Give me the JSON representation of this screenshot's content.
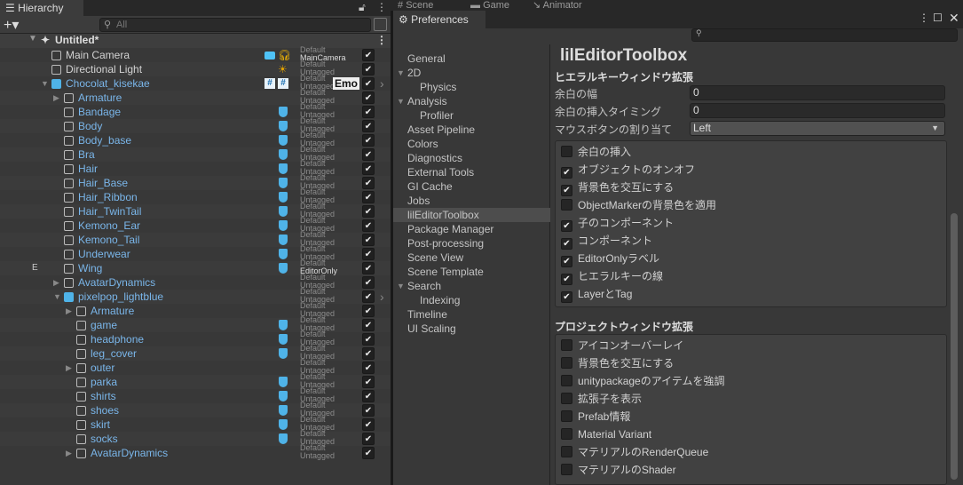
{
  "hierarchy": {
    "tab": "Hierarchy",
    "search_placeholder": "All",
    "scene": "Untitled*",
    "rows": [
      {
        "name": "Main Camera",
        "color": "white",
        "indent": 0,
        "layer": "Default",
        "tag": "MainCamera",
        "arrow": ""
      },
      {
        "name": "Directional Light",
        "color": "white",
        "indent": 0,
        "layer": "Default",
        "tag": "Untagged",
        "arrow": ""
      },
      {
        "name": "Chocolat_kisekae",
        "color": "blue",
        "indent": 0,
        "layer": "Default",
        "tag": "Untagged",
        "arrow": "▼",
        "badge": "Emo"
      },
      {
        "name": "Armature",
        "color": "blue",
        "indent": 1,
        "layer": "Default",
        "tag": "Untagged",
        "arrow": "▶"
      },
      {
        "name": "Bandage",
        "color": "blue",
        "indent": 1,
        "layer": "Default",
        "tag": "Untagged",
        "arrow": ""
      },
      {
        "name": "Body",
        "color": "blue",
        "indent": 1,
        "layer": "Default",
        "tag": "Untagged",
        "arrow": ""
      },
      {
        "name": "Body_base",
        "color": "blue",
        "indent": 1,
        "layer": "Default",
        "tag": "Untagged",
        "arrow": ""
      },
      {
        "name": "Bra",
        "color": "blue",
        "indent": 1,
        "layer": "Default",
        "tag": "Untagged",
        "arrow": ""
      },
      {
        "name": "Hair",
        "color": "blue",
        "indent": 1,
        "layer": "Default",
        "tag": "Untagged",
        "arrow": ""
      },
      {
        "name": "Hair_Base",
        "color": "blue",
        "indent": 1,
        "layer": "Default",
        "tag": "Untagged",
        "arrow": ""
      },
      {
        "name": "Hair_Ribbon",
        "color": "blue",
        "indent": 1,
        "layer": "Default",
        "tag": "Untagged",
        "arrow": ""
      },
      {
        "name": "Hair_TwinTail",
        "color": "blue",
        "indent": 1,
        "layer": "Default",
        "tag": "Untagged",
        "arrow": ""
      },
      {
        "name": "Kemono_Ear",
        "color": "blue",
        "indent": 1,
        "layer": "Default",
        "tag": "Untagged",
        "arrow": ""
      },
      {
        "name": "Kemono_Tail",
        "color": "blue",
        "indent": 1,
        "layer": "Default",
        "tag": "Untagged",
        "arrow": ""
      },
      {
        "name": "Underwear",
        "color": "blue",
        "indent": 1,
        "layer": "Default",
        "tag": "Untagged",
        "arrow": ""
      },
      {
        "name": "Wing",
        "color": "blue",
        "indent": 1,
        "layer": "Default",
        "tag": "EditorOnly",
        "arrow": "",
        "marker": "E"
      },
      {
        "name": "AvatarDynamics",
        "color": "blue",
        "indent": 1,
        "layer": "Default",
        "tag": "Untagged",
        "arrow": "▶"
      },
      {
        "name": "pixelpop_lightblue",
        "color": "blue",
        "indent": 1,
        "layer": "Default",
        "tag": "Untagged",
        "arrow": "▼"
      },
      {
        "name": "Armature",
        "color": "blue",
        "indent": 2,
        "layer": "Default",
        "tag": "Untagged",
        "arrow": "▶"
      },
      {
        "name": "game",
        "color": "blue",
        "indent": 2,
        "layer": "Default",
        "tag": "Untagged",
        "arrow": ""
      },
      {
        "name": "headphone",
        "color": "blue",
        "indent": 2,
        "layer": "Default",
        "tag": "Untagged",
        "arrow": ""
      },
      {
        "name": "leg_cover",
        "color": "blue",
        "indent": 2,
        "layer": "Default",
        "tag": "Untagged",
        "arrow": ""
      },
      {
        "name": "outer",
        "color": "blue",
        "indent": 2,
        "layer": "Default",
        "tag": "Untagged",
        "arrow": "▶"
      },
      {
        "name": "parka",
        "color": "blue",
        "indent": 2,
        "layer": "Default",
        "tag": "Untagged",
        "arrow": ""
      },
      {
        "name": "shirts",
        "color": "blue",
        "indent": 2,
        "layer": "Default",
        "tag": "Untagged",
        "arrow": ""
      },
      {
        "name": "shoes",
        "color": "blue",
        "indent": 2,
        "layer": "Default",
        "tag": "Untagged",
        "arrow": ""
      },
      {
        "name": "skirt",
        "color": "blue",
        "indent": 2,
        "layer": "Default",
        "tag": "Untagged",
        "arrow": ""
      },
      {
        "name": "socks",
        "color": "blue",
        "indent": 2,
        "layer": "Default",
        "tag": "Untagged",
        "arrow": ""
      },
      {
        "name": "AvatarDynamics",
        "color": "blue",
        "indent": 2,
        "layer": "Default",
        "tag": "Untagged",
        "arrow": "▶"
      }
    ]
  },
  "background_tabs": [
    "Scene",
    "Game",
    "Animator"
  ],
  "preferences": {
    "tab": "Preferences",
    "nav": [
      {
        "label": "General",
        "level": 0,
        "arrow": ""
      },
      {
        "label": "2D",
        "level": 0,
        "arrow": "▼"
      },
      {
        "label": "Physics",
        "level": 1,
        "arrow": ""
      },
      {
        "label": "Analysis",
        "level": 0,
        "arrow": "▼"
      },
      {
        "label": "Profiler",
        "level": 1,
        "arrow": ""
      },
      {
        "label": "Asset Pipeline",
        "level": 0,
        "arrow": ""
      },
      {
        "label": "Colors",
        "level": 0,
        "arrow": ""
      },
      {
        "label": "Diagnostics",
        "level": 0,
        "arrow": ""
      },
      {
        "label": "External Tools",
        "level": 0,
        "arrow": ""
      },
      {
        "label": "GI Cache",
        "level": 0,
        "arrow": ""
      },
      {
        "label": "Jobs",
        "level": 0,
        "arrow": ""
      },
      {
        "label": "lilEditorToolbox",
        "level": 0,
        "arrow": "",
        "selected": true
      },
      {
        "label": "Package Manager",
        "level": 0,
        "arrow": ""
      },
      {
        "label": "Post-processing",
        "level": 0,
        "arrow": ""
      },
      {
        "label": "Scene View",
        "level": 0,
        "arrow": ""
      },
      {
        "label": "Scene Template",
        "level": 0,
        "arrow": ""
      },
      {
        "label": "Search",
        "level": 0,
        "arrow": "▼"
      },
      {
        "label": "Indexing",
        "level": 1,
        "arrow": ""
      },
      {
        "label": "Timeline",
        "level": 0,
        "arrow": ""
      },
      {
        "label": "UI Scaling",
        "level": 0,
        "arrow": ""
      }
    ],
    "title": "lilEditorToolbox",
    "section1": "ヒエラルキーウィンドウ拡張",
    "fields": [
      {
        "label": "余白の幅",
        "value": "0"
      },
      {
        "label": "余白の挿入タイミング",
        "value": "0"
      },
      {
        "label": "マウスボタンの割り当て",
        "value": "Left",
        "dropdown": true
      }
    ],
    "hierarchy_options": [
      {
        "label": "余白の挿入",
        "checked": false
      },
      {
        "label": "オブジェクトのオンオフ",
        "checked": true
      },
      {
        "label": "背景色を交互にする",
        "checked": true
      },
      {
        "label": "ObjectMarkerの背景色を適用",
        "checked": false
      },
      {
        "label": "子のコンポーネント",
        "checked": true
      },
      {
        "label": "コンポーネント",
        "checked": true
      },
      {
        "label": "EditorOnlyラベル",
        "checked": true
      },
      {
        "label": "ヒエラルキーの線",
        "checked": true
      },
      {
        "label": "LayerとTag",
        "checked": true,
        "highlighted": true
      }
    ],
    "section2": "プロジェクトウィンドウ拡張",
    "project_options": [
      {
        "label": "アイコンオーバーレイ",
        "checked": false
      },
      {
        "label": "背景色を交互にする",
        "checked": false
      },
      {
        "label": "unitypackageのアイテムを強調",
        "checked": false
      },
      {
        "label": "拡張子を表示",
        "checked": false
      },
      {
        "label": "Prefab情報",
        "checked": false
      },
      {
        "label": "Material Variant",
        "checked": false
      },
      {
        "label": "マテリアルのRenderQueue",
        "checked": false
      },
      {
        "label": "マテリアルのShader",
        "checked": false
      }
    ]
  },
  "colors": {
    "highlight": "#e11111",
    "link_blue": "#7ab6ea"
  }
}
